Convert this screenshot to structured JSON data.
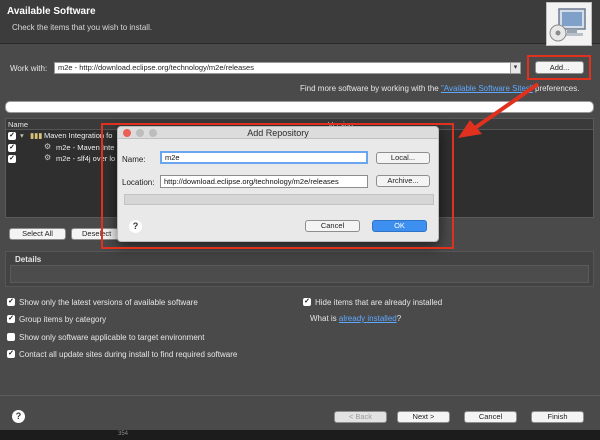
{
  "wizard": {
    "title": "Available Software",
    "subtitle": "Check the items that you wish to install.",
    "work_with_label": "Work with:",
    "work_with_value": "m2e - http://download.eclipse.org/technology/m2e/releases",
    "add_button": "Add...",
    "find_more_prefix": "Find more software by working with the ",
    "find_more_link": "\"Available Software Sites\"",
    "find_more_suffix": " preferences."
  },
  "tree": {
    "col_name": "Name",
    "col_version": "Version",
    "rows": [
      {
        "label": "Maven Integration fo",
        "checked": true
      },
      {
        "label": "m2e - Maven Inte",
        "checked": true
      },
      {
        "label": "m2e - slf4j over lo",
        "checked": true
      }
    ]
  },
  "buttons": {
    "select_all": "Select All",
    "deselect": "Deselect",
    "back": "< Back",
    "next": "Next >",
    "cancel": "Cancel",
    "finish": "Finish"
  },
  "details": {
    "label": "Details"
  },
  "options": {
    "latest_versions": "Show only the latest versions of available software",
    "hide_installed": "Hide items that are already installed",
    "group_by_category": "Group items by category",
    "what_is_prefix": "What is ",
    "what_is_link": "already installed",
    "what_is_suffix": "?",
    "target_env": "Show only software applicable to target environment",
    "contact_sites": "Contact all update sites during install to find required software",
    "checked": {
      "latest_versions": true,
      "hide_installed": true,
      "group_by_category": true,
      "target_env": false,
      "contact_sites": true
    }
  },
  "dialog": {
    "title": "Add Repository",
    "name_label": "Name:",
    "name_value": "m2e",
    "local_button": "Local...",
    "location_label": "Location:",
    "location_value": "http://download.eclipse.org/technology/m2e/releases",
    "archive_button": "Archive...",
    "cancel_button": "Cancel",
    "ok_button": "OK"
  },
  "help_icon": "?",
  "bottom_fragment": "354",
  "colors": {
    "highlight": "#e0301e",
    "link": "#5fa8ff",
    "primary_button": "#3d8ff0"
  }
}
